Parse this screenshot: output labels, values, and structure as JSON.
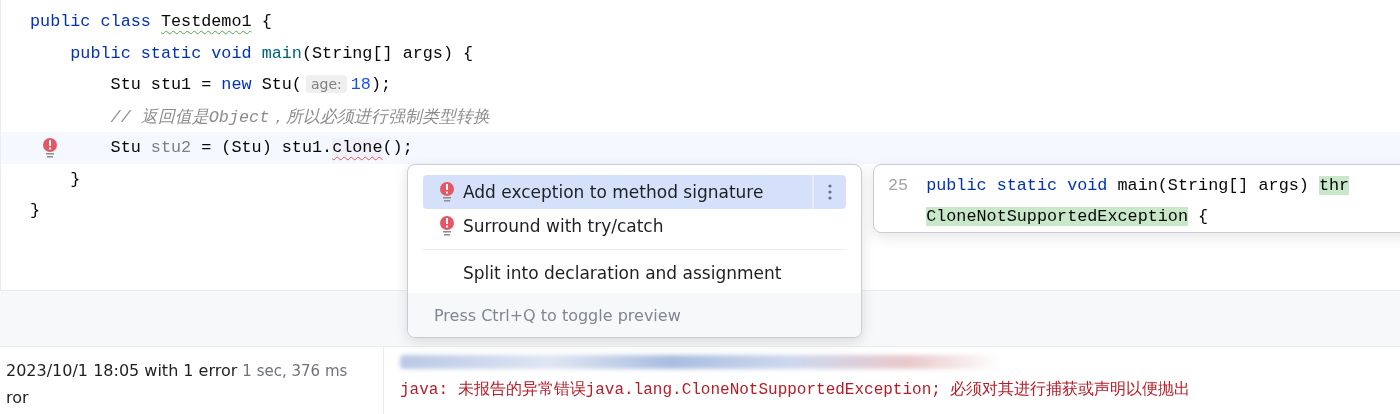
{
  "editor": {
    "lines": [
      {
        "caret_line": false,
        "error_mark": false,
        "tokens": [
          {
            "kind": "keyword",
            "text": "public class "
          },
          {
            "kind": "typo",
            "text": "Testdemo1"
          },
          {
            "kind": "plain",
            "text": " {"
          }
        ]
      },
      {
        "caret_line": false,
        "error_mark": false,
        "tokens": [
          {
            "kind": "keyword",
            "text": "    public static void "
          },
          {
            "kind": "method",
            "text": "main"
          },
          {
            "kind": "plain",
            "text": "(String[] args) {"
          }
        ]
      },
      {
        "caret_line": false,
        "error_mark": false,
        "tokens": [
          {
            "kind": "plain",
            "text": "        Stu stu1 = "
          },
          {
            "kind": "keyword",
            "text": "new "
          },
          {
            "kind": "plain",
            "text": "Stu("
          },
          {
            "kind": "hint",
            "text": "age:"
          },
          {
            "kind": "number",
            "text": "18"
          },
          {
            "kind": "plain",
            "text": ");"
          }
        ]
      },
      {
        "caret_line": false,
        "error_mark": false,
        "tokens": [
          {
            "kind": "comment",
            "text": "        // 返回值是Object，所以必须进行强制类型转换"
          }
        ]
      },
      {
        "caret_line": true,
        "error_mark": true,
        "tokens": [
          {
            "kind": "plain",
            "text": "        Stu "
          },
          {
            "kind": "unused",
            "text": "stu2"
          },
          {
            "kind": "plain",
            "text": " = (Stu) stu1."
          },
          {
            "kind": "error",
            "text": "clone"
          },
          {
            "kind": "plain",
            "text": "();"
          }
        ]
      },
      {
        "caret_line": false,
        "error_mark": false,
        "tokens": [
          {
            "kind": "plain",
            "text": "    }"
          }
        ]
      },
      {
        "caret_line": false,
        "error_mark": false,
        "tokens": [
          {
            "kind": "plain",
            "text": "}"
          }
        ]
      }
    ]
  },
  "intention_popup": {
    "items": [
      {
        "kind": "quickfix",
        "label": "Add exception to method signature",
        "selected": true
      },
      {
        "kind": "quickfix",
        "label": "Surround with try/catch",
        "selected": false
      },
      {
        "kind": "action",
        "label": "Split into declaration and assignment",
        "selected": false
      }
    ],
    "footer": "Press Ctrl+Q to toggle preview"
  },
  "preview": {
    "line_number": "25",
    "lines": [
      [
        {
          "kind": "keyword",
          "text": "public static void "
        },
        {
          "kind": "plain",
          "text": "main(String[] args) "
        },
        {
          "kind": "added",
          "text": "thr"
        }
      ],
      [
        {
          "kind": "added",
          "text": "CloneNotSupportedException"
        },
        {
          "kind": "plain",
          "text": " {"
        }
      ]
    ]
  },
  "build": {
    "status": "2023/10/1 18:05 with 1 error",
    "duration": "1 sec, 376 ms",
    "tree_item": "ror",
    "message": "java: 未报告的异常错误java.lang.CloneNotSupportedException; 必须对其进行捕获或声明以便抛出"
  }
}
